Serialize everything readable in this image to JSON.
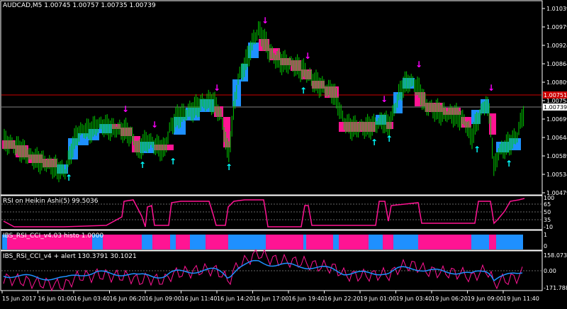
{
  "main_panel": {
    "symbol_label": "AUDCAD,M5  1.00745 1.00757 1.00735 1.00739",
    "price_ticks": [
      "1.01039",
      "1.00979",
      "1.00924",
      "1.00864",
      "1.00809",
      "1.00754",
      "1.00699",
      "1.00644",
      "1.00589",
      "1.00534",
      "1.00479"
    ],
    "current_price_bid": "1.00739",
    "current_price_ask": "1.00751"
  },
  "rsi_panel": {
    "label": "RSI on Heikin Ashi(5) 99.5036",
    "ticks": [
      "100",
      "65",
      "50",
      "35",
      "-10"
    ]
  },
  "histo_panel": {
    "label": "IBS_RSI_CCI_v4.03 histo 1.0000",
    "ticks": [
      "1",
      "0"
    ]
  },
  "cci_panel": {
    "label": "IBS_RSI_CCI_v4 + alert 130.3791 30.1021",
    "ticks": [
      "158.0731",
      "0.00",
      "-171.7883"
    ]
  },
  "time_axis": [
    "15 Jun 2017",
    "16 Jun 01:00",
    "16 Jun 03:40",
    "16 Jun 06:20",
    "16 Jun 09:00",
    "16 Jun 11:40",
    "16 Jun 14:20",
    "16 Jun 17:00",
    "16 Jun 19:40",
    "16 Jun 22:20",
    "19 Jun 01:00",
    "19 Jun 03:40",
    "19 Jun 06:20",
    "19 Jun 09:00",
    "19 Jun 11:40"
  ],
  "colors": {
    "background": "#000000",
    "price_line": "#00cc00",
    "ha_bull": "#1e90ff",
    "ha_bear": "#ff1493",
    "rsi_line": "#ff1493",
    "cci_line": "#ff1493",
    "signal_line": "#1e90ff",
    "arrow_up": "#00ffff",
    "arrow_down": "#ff00ff",
    "ask_line": "#cc0000",
    "bid_line": "#808080"
  }
}
